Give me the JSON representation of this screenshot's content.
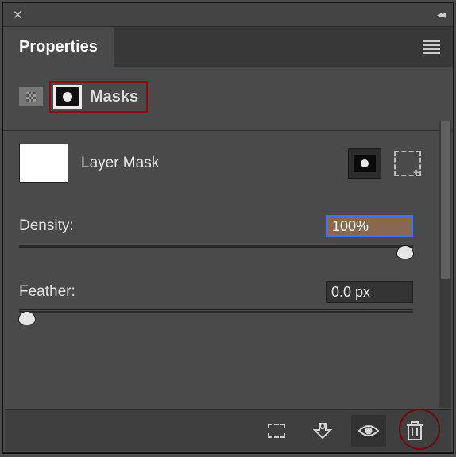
{
  "panel": {
    "title": "Properties"
  },
  "header": {
    "section": "Masks"
  },
  "mask": {
    "name": "Layer Mask"
  },
  "sliders": {
    "density": {
      "label": "Density:",
      "value": "100%",
      "position": 100
    },
    "feather": {
      "label": "Feather:",
      "value": "0.0 px",
      "position": 0
    }
  }
}
